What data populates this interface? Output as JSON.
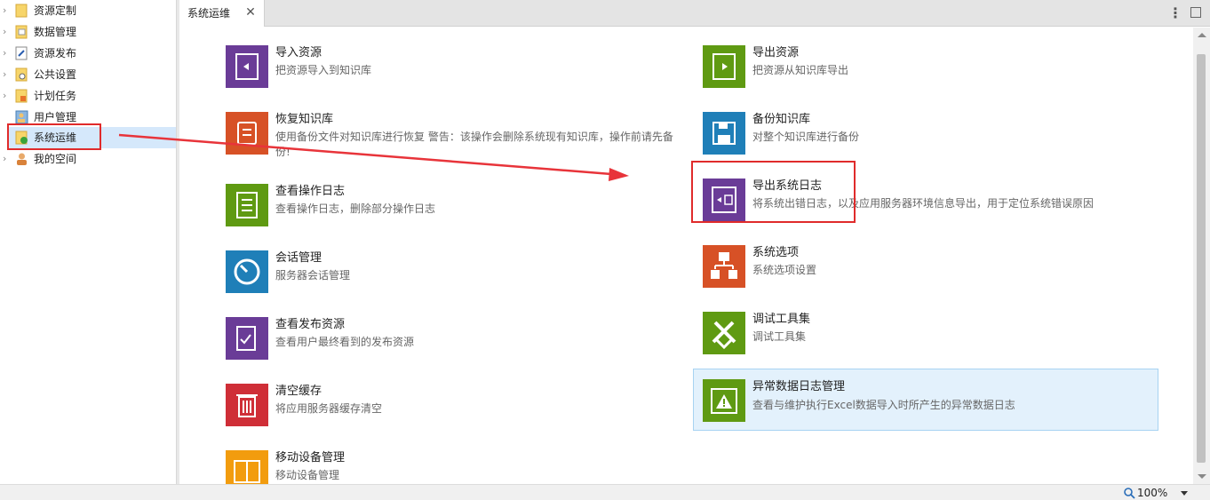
{
  "sidebar": {
    "items": [
      {
        "label": "资源定制",
        "icon": "folder-icon",
        "expandable": true
      },
      {
        "label": "数据管理",
        "icon": "data-file-icon",
        "expandable": true
      },
      {
        "label": "资源发布",
        "icon": "publish-icon",
        "expandable": true
      },
      {
        "label": "公共设置",
        "icon": "settings-file-icon",
        "expandable": true
      },
      {
        "label": "计划任务",
        "icon": "rss-file-icon",
        "expandable": true
      },
      {
        "label": "用户管理",
        "icon": "user-card-icon",
        "expandable": false
      },
      {
        "label": "系统运维",
        "icon": "maintenance-icon",
        "expandable": false,
        "selected": true
      },
      {
        "label": "我的空间",
        "icon": "person-icon",
        "expandable": true
      }
    ]
  },
  "tabs": {
    "active_label": "系统运维",
    "close_glyph": "✕",
    "more_glyph": "⋮"
  },
  "cards": [
    {
      "title": "导入资源",
      "desc": "把资源导入到知识库",
      "color": "#6a3c97",
      "icon": "import-book-icon"
    },
    {
      "title": "导出资源",
      "desc": "把资源从知识库导出",
      "color": "#5f9a12",
      "icon": "export-book-icon"
    },
    {
      "title": "恢复知识库",
      "desc": "使用备份文件对知识库进行恢复 警告：该操作会删除系统现有知识库，操作前请先备份!",
      "color": "#d75126",
      "icon": "restore-icon"
    },
    {
      "title": "备份知识库",
      "desc": "对整个知识库进行备份",
      "color": "#1f7fb8",
      "icon": "floppy-icon"
    },
    {
      "title": "查看操作日志",
      "desc": "查看操作日志，删除部分操作日志",
      "color": "#5f9a12",
      "icon": "clipboard-log-icon"
    },
    {
      "title": "导出系统日志",
      "desc": "将系统出错日志，以及应用服务器环境信息导出，用于定位系统错误原因",
      "color": "#6a3c97",
      "icon": "export-log-icon"
    },
    {
      "title": "会话管理",
      "desc": "服务器会话管理",
      "color": "#1f7fb8",
      "icon": "gauge-icon"
    },
    {
      "title": "系统选项",
      "desc": "系统选项设置",
      "color": "#d75126",
      "icon": "options-tree-icon"
    },
    {
      "title": "查看发布资源",
      "desc": "查看用户最终看到的发布资源",
      "color": "#6a3c97",
      "icon": "checklist-icon"
    },
    {
      "title": "调试工具集",
      "desc": "调试工具集",
      "color": "#5f9a12",
      "icon": "tools-icon"
    },
    {
      "title": "清空缓存",
      "desc": "将应用服务器缓存清空",
      "color": "#cf2e37",
      "icon": "trash-icon"
    },
    {
      "title": "异常数据日志管理",
      "desc": "查看与维护执行Excel数据导入时所产生的异常数据日志",
      "color": "#5f9a12",
      "icon": "warning-calendar-icon"
    },
    {
      "title": "移动设备管理",
      "desc": "移动设备管理",
      "color": "#f29c0e",
      "icon": "mobile-device-icon"
    }
  ],
  "status": {
    "zoom": "100%"
  }
}
